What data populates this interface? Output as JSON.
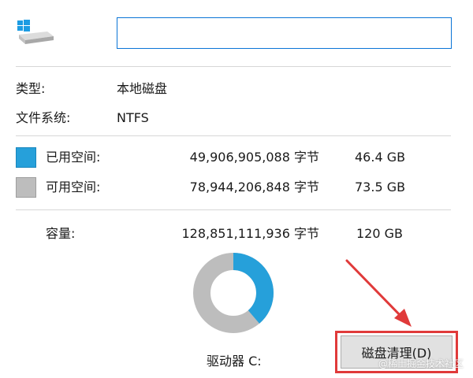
{
  "drive_name_input": {
    "value": "",
    "placeholder": ""
  },
  "info": {
    "type_label": "类型:",
    "type_value": "本地磁盘",
    "fs_label": "文件系统:",
    "fs_value": "NTFS"
  },
  "space": {
    "used": {
      "label": "已用空间:",
      "bytes": "49,906,905,088 字节",
      "size": "46.4 GB",
      "color": "#26a0da"
    },
    "free": {
      "label": "可用空间:",
      "bytes": "78,944,206,848 字节",
      "size": "73.5 GB",
      "color": "#bdbdbd"
    },
    "capacity": {
      "label": "容量:",
      "bytes": "128,851,111,936 字节",
      "size": "120 GB"
    }
  },
  "usage_chart": {
    "used_fraction": 0.387
  },
  "drive_label": "驱动器 C:",
  "cleanup_button_label": "磁盘清理(D)",
  "annotation": {
    "arrow_color": "#e03a3a",
    "box_color": "#e03a3a"
  },
  "watermark": "@稀土掘金技术社区"
}
